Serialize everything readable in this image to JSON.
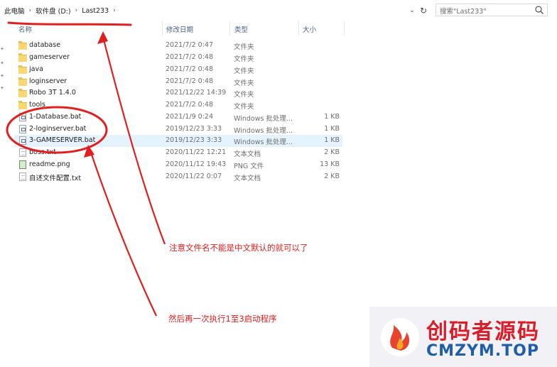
{
  "breadcrumb": [
    "此电脑",
    "软件盘 (D:)",
    "Last233"
  ],
  "search": {
    "placeholder": "搜索\"Last233\""
  },
  "columns": {
    "name": "名称",
    "date": "修改日期",
    "type": "类型",
    "size": "大小"
  },
  "files": [
    {
      "name": "database",
      "date": "2021/7/2 0:47",
      "type": "文件夹",
      "size": "",
      "icon": "folder-icon"
    },
    {
      "name": "gameserver",
      "date": "2021/7/2 0:48",
      "type": "文件夹",
      "size": "",
      "icon": "folder-icon"
    },
    {
      "name": "java",
      "date": "2021/7/2 0:48",
      "type": "文件夹",
      "size": "",
      "icon": "folder-icon"
    },
    {
      "name": "loginserver",
      "date": "2021/7/2 0:48",
      "type": "文件夹",
      "size": "",
      "icon": "folder-icon"
    },
    {
      "name": "Robo 3T 1.4.0",
      "date": "2021/12/22 14:39",
      "type": "文件夹",
      "size": "",
      "icon": "folder-icon"
    },
    {
      "name": "tools",
      "date": "2021/7/2 0:48",
      "type": "文件夹",
      "size": "",
      "icon": "folder-icon"
    },
    {
      "name": "1-Database.bat",
      "date": "2021/1/9 0:24",
      "type": "Windows 批处理...",
      "size": "1 KB",
      "icon": "batch-file-icon"
    },
    {
      "name": "2-loginserver.bat",
      "date": "2019/12/23 3:33",
      "type": "Windows 批处理...",
      "size": "1 KB",
      "icon": "batch-file-icon"
    },
    {
      "name": "3-GAMESERVER.bat",
      "date": "2019/12/23 3:33",
      "type": "Windows 批处理...",
      "size": "1 KB",
      "icon": "batch-file-icon",
      "selected": true
    },
    {
      "name": "boss.txt",
      "date": "2020/11/22 12:21",
      "type": "文本文档",
      "size": "2 KB",
      "icon": "text-file-icon"
    },
    {
      "name": "readme.png",
      "date": "2020/11/12 19:43",
      "type": "PNG 文件",
      "size": "13 KB",
      "icon": "image-file-icon"
    },
    {
      "name": "自述文件配置.txt",
      "date": "2020/11/22 0:07",
      "type": "文本文档",
      "size": "2 KB",
      "icon": "text-file-icon"
    }
  ],
  "annotations": {
    "note1": "注意文件名不能是中文默认的就可以了",
    "note2": "然后再一次执行1至3启动程序"
  },
  "watermark": {
    "cn": "创码者源码",
    "en": "CMZYM.TOP"
  },
  "colors": {
    "annotation": "#e02020",
    "selection": "#e5f3ff",
    "folder": "#f8d775",
    "watermark_red": "#d81e28",
    "watermark_blue": "#1f5fa8"
  }
}
